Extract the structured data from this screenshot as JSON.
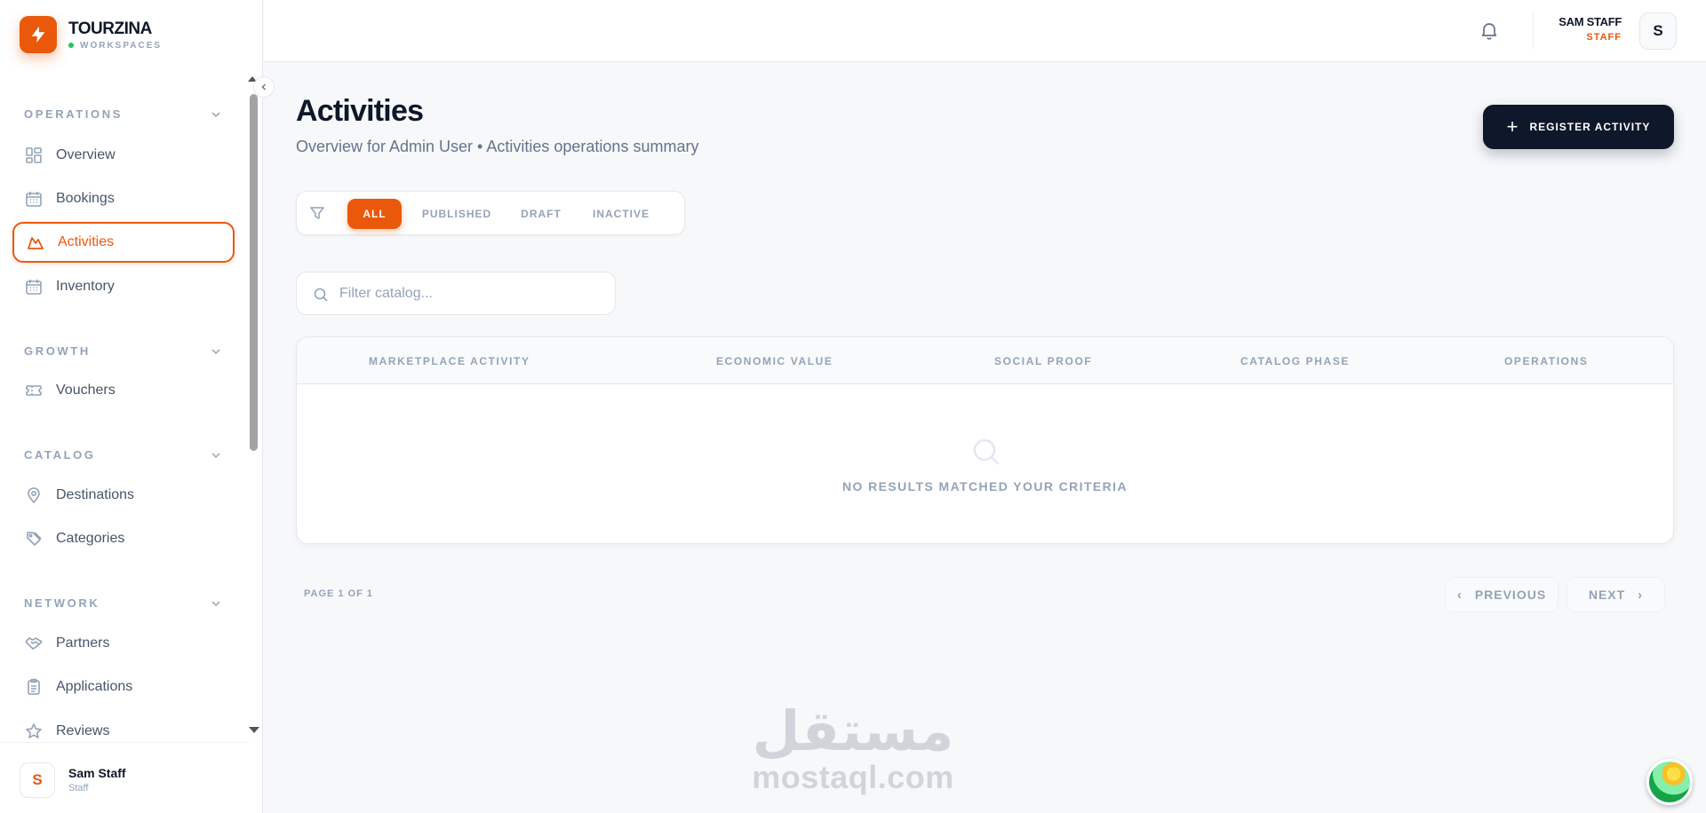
{
  "brand": {
    "name": "TOURZINA",
    "sub": "WORKSPACES"
  },
  "sidebar": {
    "sections": [
      {
        "label": "OPERATIONS",
        "items": [
          "Overview",
          "Bookings",
          "Activities",
          "Inventory"
        ]
      },
      {
        "label": "GROWTH",
        "items": [
          "Vouchers"
        ]
      },
      {
        "label": "CATALOG",
        "items": [
          "Destinations",
          "Categories"
        ]
      },
      {
        "label": "NETWORK",
        "items": [
          "Partners",
          "Applications",
          "Reviews"
        ]
      }
    ],
    "active_item": "Activities",
    "footer": {
      "avatar": "S",
      "name": "Sam Staff",
      "role": "Staff"
    }
  },
  "header": {
    "user_name": "SAM STAFF",
    "user_role": "STAFF",
    "avatar": "S"
  },
  "main": {
    "title": "Activities",
    "subtitle": "Overview for Admin User • Activities operations summary",
    "register_label": "REGISTER ACTIVITY",
    "filters": [
      "ALL",
      "PUBLISHED",
      "DRAFT",
      "INACTIVE"
    ],
    "active_filter": "ALL",
    "search_placeholder": "Filter catalog...",
    "table": {
      "columns": [
        "MARKETPLACE ACTIVITY",
        "ECONOMIC VALUE",
        "SOCIAL PROOF",
        "CATALOG PHASE",
        "OPERATIONS"
      ],
      "empty_text": "NO RESULTS MATCHED YOUR CRITERIA"
    },
    "pagination": {
      "info": "PAGE 1 OF 1",
      "prev": "PREVIOUS",
      "next": "NEXT"
    }
  },
  "watermark": {
    "arabic": "مستقل",
    "latin": "mostaql.com"
  },
  "colors": {
    "accent": "#ea580c",
    "dark": "#0f172a",
    "muted": "#94a3b8"
  }
}
